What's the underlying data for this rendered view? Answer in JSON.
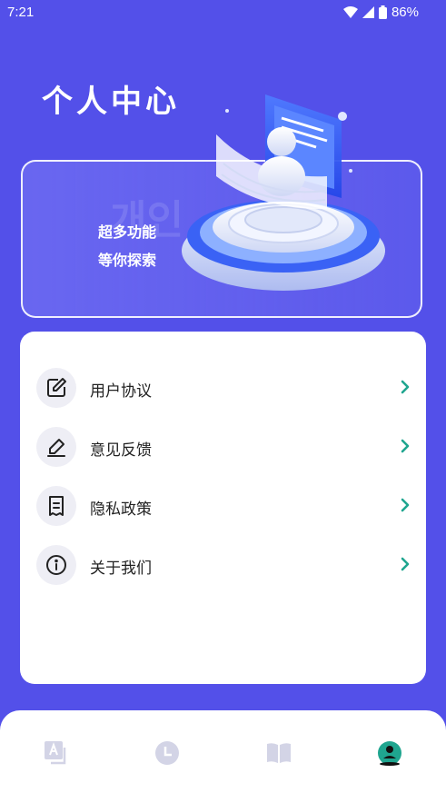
{
  "status_bar": {
    "time": "7:21",
    "battery": "86%"
  },
  "header": {
    "title": "个人中心"
  },
  "banner": {
    "line1": "超多功能",
    "line2": "等你探索",
    "watermark": "개인"
  },
  "menu": [
    {
      "label": "用户协议",
      "icon": "edit-document-icon"
    },
    {
      "label": "意见反馈",
      "icon": "pen-icon"
    },
    {
      "label": "隐私政策",
      "icon": "receipt-icon"
    },
    {
      "label": "关于我们",
      "icon": "info-icon"
    }
  ],
  "tabs": [
    {
      "icon": "translate-icon",
      "active": false
    },
    {
      "icon": "clock-icon",
      "active": false
    },
    {
      "icon": "book-icon",
      "active": false
    },
    {
      "icon": "profile-icon",
      "active": true
    }
  ],
  "colors": {
    "background": "#5350e9",
    "accent": "#1fa58f",
    "inactive_tab": "#d3d4e6"
  }
}
